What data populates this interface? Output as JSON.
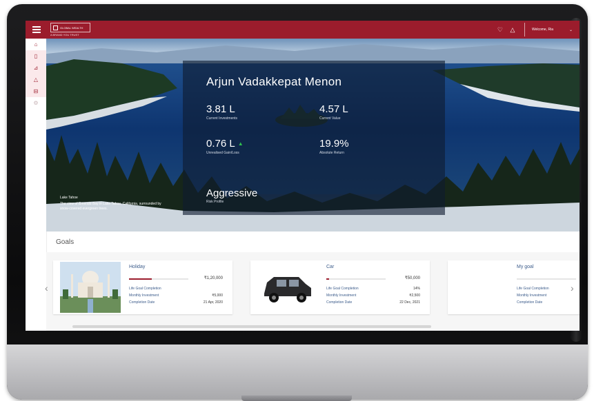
{
  "topbar": {
    "brand_name": "GLOBAL WEALTH",
    "brand_tagline": "A BRAND YOU TRUST",
    "user_name": "Welcome, Ria"
  },
  "sidenav": {
    "items": [
      {
        "icon": "home-icon",
        "glyph": "⌂"
      },
      {
        "icon": "document-icon",
        "glyph": "▯"
      },
      {
        "icon": "chart-icon",
        "glyph": "⊿"
      },
      {
        "icon": "bell-icon",
        "glyph": "△"
      },
      {
        "icon": "calendar-icon",
        "glyph": "⊟"
      },
      {
        "icon": "settings-icon",
        "glyph": "⚙"
      }
    ]
  },
  "hero": {
    "caption_title": "Lake Tahoe",
    "caption_text": "The view of Emerald Bay in Lake Tahoe, California, surrounded by snow-covered evergreen trees."
  },
  "profile": {
    "name": "Arjun Vadakkepat Menon",
    "stats": [
      {
        "value": "3.81 L",
        "label": "Current Investments"
      },
      {
        "value": "4.57 L",
        "label": "Current Value"
      },
      {
        "value": "0.76 L",
        "label": "Unrealised Gain/Loss",
        "trend": "up"
      },
      {
        "value": "19.9%",
        "label": "Absolute Return"
      }
    ],
    "risk_value": "Aggressive",
    "risk_label": "Risk Profile"
  },
  "goals": {
    "title": "Goals",
    "cards": [
      {
        "name": "Holiday",
        "amount": "₹1,20,000",
        "progress": 0.38,
        "rows": [
          [
            "Life Goal Completion",
            ""
          ],
          [
            "Monthly Investment",
            "₹5,000"
          ],
          [
            "Completion Date",
            "21 Apr, 2020"
          ]
        ]
      },
      {
        "name": "Car",
        "amount": "₹50,000",
        "progress": 0.05,
        "rows": [
          [
            "Life Goal Completion",
            "14%"
          ],
          [
            "Monthly Investment",
            "₹2,500"
          ],
          [
            "Completion Date",
            "22 Dec, 2021"
          ]
        ]
      },
      {
        "name": "My goal",
        "amount": "",
        "progress": 0.0,
        "rows": [
          [
            "Life Goal Completion",
            ""
          ],
          [
            "Monthly Investment",
            ""
          ],
          [
            "Completion Date",
            ""
          ]
        ]
      }
    ]
  },
  "colors": {
    "brand": "#9b1c2c",
    "progress_up": "#2fbf4f"
  }
}
